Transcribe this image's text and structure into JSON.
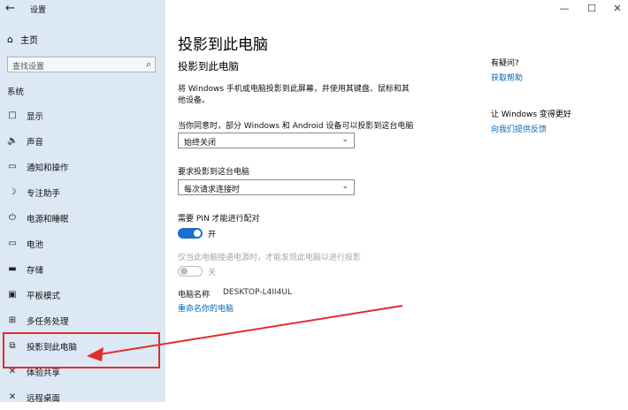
{
  "app": {
    "title": "设置"
  },
  "titlebar": {
    "back": "←",
    "minimize": "—",
    "maximize": "☐",
    "close": "✕"
  },
  "sidebar": {
    "home": "主页",
    "search_placeholder": "查找设置",
    "section": "系统",
    "items": [
      {
        "label": "显示",
        "icon": "□"
      },
      {
        "label": "声音",
        "icon": "🔈"
      },
      {
        "label": "通知和操作",
        "icon": "▭"
      },
      {
        "label": "专注助手",
        "icon": "☽"
      },
      {
        "label": "电源和睡眠",
        "icon": "⏻"
      },
      {
        "label": "电池",
        "icon": "▭"
      },
      {
        "label": "存储",
        "icon": "▬"
      },
      {
        "label": "平板模式",
        "icon": "▣"
      },
      {
        "label": "多任务处理",
        "icon": "⊞"
      },
      {
        "label": "投影到此电脑",
        "icon": "⧉"
      },
      {
        "label": "体验共享",
        "icon": "✕"
      },
      {
        "label": "远程桌面",
        "icon": "✕"
      }
    ]
  },
  "main": {
    "page_title": "投影到此电脑",
    "section_title": "投影到此电脑",
    "description": "将 Windows 手机或电脑投影到此屏幕，并使用其键盘、鼠标和其他设备。",
    "setting1": {
      "label": "当你同意时，部分 Windows 和 Android 设备可以投影到这台电脑",
      "value": "始终关闭"
    },
    "setting2": {
      "label": "要求投影到这台电脑",
      "value": "每次请求连接时"
    },
    "setting3": {
      "label": "需要 PIN 才能进行配对",
      "state": "开"
    },
    "setting4": {
      "label": "仅当此电脑接通电源时，才能发现此电脑以进行投影",
      "state": "关"
    },
    "pc_name_label": "电脑名称",
    "pc_name_value": "DESKTOP-L4II4UL",
    "rename_link": "重命名你的电脑"
  },
  "aside": {
    "question": "有疑问?",
    "help_link": "获取帮助",
    "improve": "让 Windows 变得更好",
    "feedback_link": "向我们提供反馈"
  },
  "colors": {
    "accent": "#1a6fd0",
    "link": "#0067b8",
    "sidebar_bg": "#dce8f3",
    "annotation": "#e12c2c"
  }
}
